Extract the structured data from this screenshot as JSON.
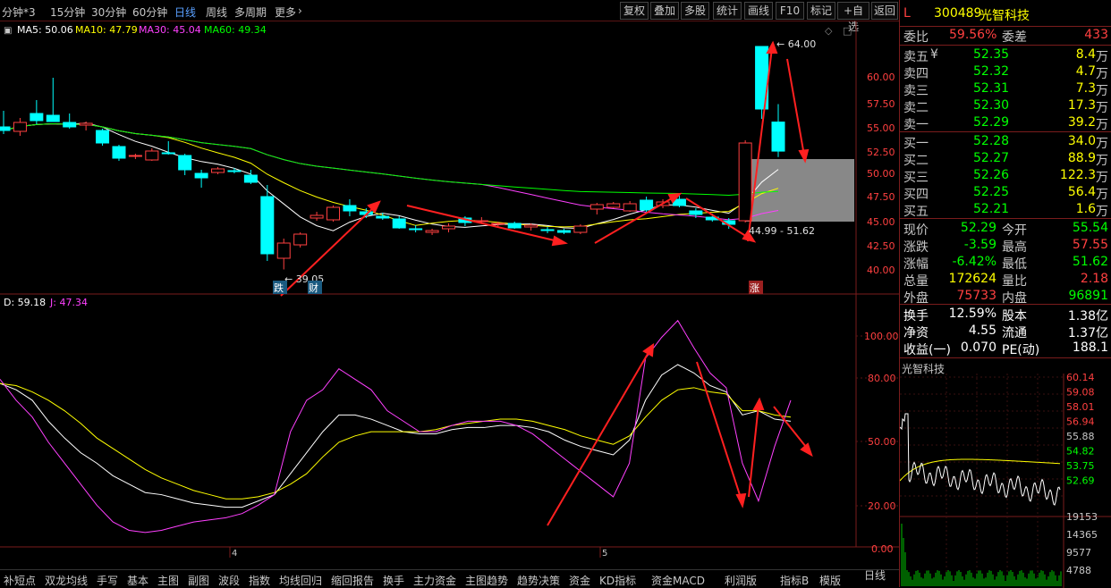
{
  "toolbar": {
    "periods": [
      "分钟*3",
      "15分钟",
      "30分钟",
      "60分钟",
      "日线",
      "周线",
      "多周期",
      "更多"
    ],
    "active_period": "日线",
    "buttons": [
      "复权",
      "叠加",
      "多股",
      "统计",
      "画线",
      "F10",
      "标记",
      "+自选",
      "返回"
    ]
  },
  "ma_legend": {
    "ma5": "MA5: 50.06",
    "ma10": "MA10: 47.79",
    "ma30": "MA30: 45.04",
    "ma60": "MA60: 49.34"
  },
  "kdj_legend": {
    "d": "D: 59.18",
    "j": "J: 47.34"
  },
  "price_axis": [
    "60.00",
    "57.50",
    "55.00",
    "52.50",
    "50.00",
    "47.50",
    "45.00",
    "42.50",
    "40.00"
  ],
  "kdj_axis": [
    "100.00",
    "80.00",
    "50.00",
    "20.00",
    "0.00"
  ],
  "annotations": {
    "high_label": "64.00",
    "low_label": "39.05",
    "range_label": "44.99 - 51.62",
    "marker_die": "跌",
    "marker_cai": "财",
    "marker_zhang": "涨",
    "month4": "4",
    "month5": "5"
  },
  "colors": {
    "up": "#ff4040",
    "down": "#00ffff",
    "ma5": "#ffffff",
    "ma10": "#ffff00",
    "ma30": "#ff40ff",
    "ma60": "#00ff00",
    "arrow": "#ff2020",
    "bg": "#000000"
  },
  "stock": {
    "flag": "L",
    "code": "300489",
    "name": "光智科技"
  },
  "weibi": {
    "label1": "委比",
    "value1": "59.56%",
    "label2": "委差",
    "value2": "433"
  },
  "asks": [
    {
      "label": "卖五",
      "mark": "¥",
      "price": "52.35",
      "vol": "8.4",
      "unit": "万"
    },
    {
      "label": "卖四",
      "mark": "",
      "price": "52.32",
      "vol": "4.7",
      "unit": "万"
    },
    {
      "label": "卖三",
      "mark": "",
      "price": "52.31",
      "vol": "7.3",
      "unit": "万"
    },
    {
      "label": "卖二",
      "mark": "",
      "price": "52.30",
      "vol": "17.3",
      "unit": "万"
    },
    {
      "label": "卖一",
      "mark": "",
      "price": "52.29",
      "vol": "39.2",
      "unit": "万"
    }
  ],
  "bids": [
    {
      "label": "买一",
      "price": "52.28",
      "vol": "34.0",
      "unit": "万"
    },
    {
      "label": "买二",
      "price": "52.27",
      "vol": "88.9",
      "unit": "万"
    },
    {
      "label": "买三",
      "price": "52.26",
      "vol": "122.3",
      "unit": "万"
    },
    {
      "label": "买四",
      "price": "52.25",
      "vol": "56.4",
      "unit": "万"
    },
    {
      "label": "买五",
      "price": "52.21",
      "vol": "1.6",
      "unit": "万"
    }
  ],
  "stats": [
    {
      "l1": "现价",
      "v1": "52.29",
      "c1": "#00ff00",
      "l2": "今开",
      "v2": "55.54",
      "c2": "#00ff00"
    },
    {
      "l1": "涨跌",
      "v1": "-3.59",
      "c1": "#00ff00",
      "l2": "最高",
      "v2": "57.55",
      "c2": "#ff4040"
    },
    {
      "l1": "涨幅",
      "v1": "-6.42%",
      "c1": "#00ff00",
      "l2": "最低",
      "v2": "51.62",
      "c2": "#00ff00"
    },
    {
      "l1": "总量",
      "v1": "172624",
      "c1": "#ffff00",
      "l2": "量比",
      "v2": "2.18",
      "c2": "#ff4040"
    },
    {
      "l1": "外盘",
      "v1": "75733",
      "c1": "#ff4040",
      "l2": "内盘",
      "v2": "96891",
      "c2": "#00ff00"
    }
  ],
  "fund": [
    {
      "l1": "换手",
      "v1": "12.59%",
      "l2": "股本",
      "v2": "1.38亿"
    },
    {
      "l1": "净资",
      "v1": "4.55",
      "l2": "流通",
      "v2": "1.37亿"
    },
    {
      "l1": "收益(一)",
      "v1": "0.070",
      "l2": "PE(动)",
      "v2": "188.1"
    }
  ],
  "mini": {
    "title": "光智科技",
    "price_labels": [
      "60.14",
      "59.08",
      "58.01",
      "56.94",
      "55.88",
      "54.82",
      "53.75",
      "52.69"
    ],
    "vol_labels": [
      "19153",
      "14365",
      "9577",
      "4788"
    ]
  },
  "bottom": {
    "tabs": [
      "补短点",
      "双龙均线",
      "手写",
      "基本",
      "主图",
      "副图",
      "波段",
      "指数",
      "均线回归",
      "缩回报告",
      "换手",
      "主力资金",
      "主图趋势",
      "趋势决策",
      "资金",
      "KD指标",
      "资金MACD",
      "利润版"
    ],
    "right": [
      "指标B",
      "模版"
    ],
    "period_corner": "日线"
  },
  "chart_data": {
    "type": "candlestick",
    "price_ylim": [
      38.0,
      65.0
    ],
    "ohlc": [
      [
        55.0,
        56.8,
        54.2,
        54.6
      ],
      [
        54.5,
        56.0,
        54.0,
        55.5
      ],
      [
        56.5,
        58.0,
        55.3,
        55.7
      ],
      [
        56.3,
        60.5,
        55.8,
        55.6
      ],
      [
        55.5,
        56.5,
        54.8,
        55.0
      ],
      [
        55.2,
        55.6,
        54.6,
        55.4
      ],
      [
        54.6,
        54.8,
        52.9,
        53.2
      ],
      [
        52.8,
        53.0,
        51.2,
        51.5
      ],
      [
        51.8,
        52.0,
        51.4,
        51.8
      ],
      [
        51.3,
        52.6,
        51.2,
        52.3
      ],
      [
        52.1,
        53.4,
        51.9,
        52.0
      ],
      [
        51.8,
        52.0,
        49.6,
        50.2
      ],
      [
        49.8,
        50.2,
        48.2,
        49.3
      ],
      [
        49.9,
        50.5,
        49.7,
        50.3
      ],
      [
        50.1,
        50.4,
        49.8,
        50.0
      ],
      [
        49.6,
        50.2,
        48.6,
        48.8
      ],
      [
        47.2,
        48.5,
        40.0,
        40.8
      ],
      [
        40.3,
        42.5,
        39.05,
        42.0
      ],
      [
        41.8,
        43.2,
        41.5,
        43.0
      ],
      [
        44.8,
        45.5,
        44.5,
        45.1
      ],
      [
        44.6,
        46.2,
        44.4,
        46.0
      ],
      [
        46.2,
        46.9,
        45.0,
        45.6
      ],
      [
        45.5,
        45.9,
        44.8,
        45.2
      ],
      [
        45.0,
        45.4,
        44.6,
        44.8
      ],
      [
        44.7,
        45.0,
        43.6,
        43.7
      ],
      [
        43.6,
        44.0,
        43.2,
        43.5
      ],
      [
        43.2,
        43.6,
        42.9,
        43.4
      ],
      [
        43.6,
        44.2,
        43.2,
        43.9
      ],
      [
        44.8,
        45.0,
        43.9,
        44.3
      ],
      [
        44.5,
        44.9,
        44.3,
        44.5
      ],
      [
        44.1,
        44.4,
        43.8,
        44.2
      ],
      [
        44.2,
        44.4,
        43.6,
        43.7
      ],
      [
        43.8,
        44.2,
        43.4,
        44.0
      ],
      [
        43.5,
        43.8,
        43.1,
        43.4
      ],
      [
        43.4,
        43.6,
        43.0,
        43.2
      ],
      [
        43.2,
        44.1,
        43.0,
        43.9
      ],
      [
        45.8,
        46.5,
        45.2,
        46.3
      ],
      [
        46.0,
        46.6,
        45.9,
        46.4
      ],
      [
        45.6,
        46.7,
        45.5,
        46.4
      ],
      [
        46.8,
        47.2,
        45.5,
        45.7
      ],
      [
        46.2,
        46.9,
        45.9,
        46.6
      ],
      [
        46.9,
        47.4,
        46.0,
        46.2
      ],
      [
        45.6,
        45.9,
        44.8,
        45.2
      ],
      [
        44.9,
        45.3,
        44.4,
        44.6
      ],
      [
        44.5,
        44.8,
        43.6,
        44.1
      ],
      [
        44.5,
        53.5,
        44.3,
        53.2
      ],
      [
        64.0,
        64.0,
        55.9,
        57.0
      ],
      [
        55.54,
        57.55,
        51.62,
        52.29
      ]
    ],
    "kdj_ylim": [
      -5,
      110
    ],
    "k": [
      78,
      75,
      70,
      60,
      52,
      45,
      40,
      34,
      30,
      26,
      25,
      23,
      21,
      20,
      19,
      19,
      22,
      25,
      35,
      45,
      55,
      63,
      63,
      61,
      58,
      55,
      54,
      54,
      56,
      57,
      57,
      58,
      58,
      57,
      55,
      51,
      48,
      46,
      44,
      51,
      70,
      82,
      87,
      83,
      77,
      74,
      63,
      65,
      61,
      60
    ],
    "d": [
      78,
      77,
      74,
      70,
      65,
      59,
      52,
      47,
      42,
      37,
      33,
      30,
      27,
      25,
      23,
      23,
      24,
      26,
      30,
      35,
      43,
      50,
      53,
      55,
      55,
      55,
      55,
      56,
      58,
      59,
      60,
      61,
      61,
      60,
      58,
      56,
      53,
      51,
      49,
      53,
      62,
      70,
      75,
      76,
      74,
      73,
      65,
      65,
      63,
      62
    ],
    "j": [
      80,
      70,
      62,
      50,
      40,
      30,
      20,
      12,
      8,
      7,
      8,
      10,
      12,
      13,
      14,
      16,
      20,
      25,
      55,
      70,
      75,
      85,
      80,
      75,
      65,
      60,
      55,
      55,
      58,
      60,
      60,
      60,
      58,
      54,
      48,
      42,
      36,
      30,
      24,
      40,
      90,
      100,
      108,
      95,
      83,
      76,
      40,
      22,
      48,
      70
    ]
  }
}
